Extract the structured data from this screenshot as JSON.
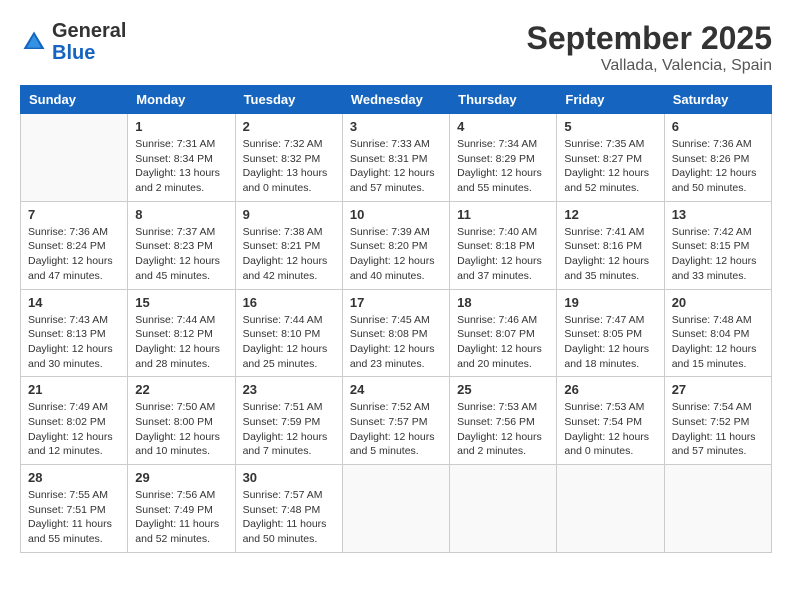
{
  "header": {
    "logo_general": "General",
    "logo_blue": "Blue",
    "month_title": "September 2025",
    "location": "Vallada, Valencia, Spain"
  },
  "days_of_week": [
    "Sunday",
    "Monday",
    "Tuesday",
    "Wednesday",
    "Thursday",
    "Friday",
    "Saturday"
  ],
  "weeks": [
    [
      {
        "day": "",
        "info": ""
      },
      {
        "day": "1",
        "info": "Sunrise: 7:31 AM\nSunset: 8:34 PM\nDaylight: 13 hours\nand 2 minutes."
      },
      {
        "day": "2",
        "info": "Sunrise: 7:32 AM\nSunset: 8:32 PM\nDaylight: 13 hours\nand 0 minutes."
      },
      {
        "day": "3",
        "info": "Sunrise: 7:33 AM\nSunset: 8:31 PM\nDaylight: 12 hours\nand 57 minutes."
      },
      {
        "day": "4",
        "info": "Sunrise: 7:34 AM\nSunset: 8:29 PM\nDaylight: 12 hours\nand 55 minutes."
      },
      {
        "day": "5",
        "info": "Sunrise: 7:35 AM\nSunset: 8:27 PM\nDaylight: 12 hours\nand 52 minutes."
      },
      {
        "day": "6",
        "info": "Sunrise: 7:36 AM\nSunset: 8:26 PM\nDaylight: 12 hours\nand 50 minutes."
      }
    ],
    [
      {
        "day": "7",
        "info": "Sunrise: 7:36 AM\nSunset: 8:24 PM\nDaylight: 12 hours\nand 47 minutes."
      },
      {
        "day": "8",
        "info": "Sunrise: 7:37 AM\nSunset: 8:23 PM\nDaylight: 12 hours\nand 45 minutes."
      },
      {
        "day": "9",
        "info": "Sunrise: 7:38 AM\nSunset: 8:21 PM\nDaylight: 12 hours\nand 42 minutes."
      },
      {
        "day": "10",
        "info": "Sunrise: 7:39 AM\nSunset: 8:20 PM\nDaylight: 12 hours\nand 40 minutes."
      },
      {
        "day": "11",
        "info": "Sunrise: 7:40 AM\nSunset: 8:18 PM\nDaylight: 12 hours\nand 37 minutes."
      },
      {
        "day": "12",
        "info": "Sunrise: 7:41 AM\nSunset: 8:16 PM\nDaylight: 12 hours\nand 35 minutes."
      },
      {
        "day": "13",
        "info": "Sunrise: 7:42 AM\nSunset: 8:15 PM\nDaylight: 12 hours\nand 33 minutes."
      }
    ],
    [
      {
        "day": "14",
        "info": "Sunrise: 7:43 AM\nSunset: 8:13 PM\nDaylight: 12 hours\nand 30 minutes."
      },
      {
        "day": "15",
        "info": "Sunrise: 7:44 AM\nSunset: 8:12 PM\nDaylight: 12 hours\nand 28 minutes."
      },
      {
        "day": "16",
        "info": "Sunrise: 7:44 AM\nSunset: 8:10 PM\nDaylight: 12 hours\nand 25 minutes."
      },
      {
        "day": "17",
        "info": "Sunrise: 7:45 AM\nSunset: 8:08 PM\nDaylight: 12 hours\nand 23 minutes."
      },
      {
        "day": "18",
        "info": "Sunrise: 7:46 AM\nSunset: 8:07 PM\nDaylight: 12 hours\nand 20 minutes."
      },
      {
        "day": "19",
        "info": "Sunrise: 7:47 AM\nSunset: 8:05 PM\nDaylight: 12 hours\nand 18 minutes."
      },
      {
        "day": "20",
        "info": "Sunrise: 7:48 AM\nSunset: 8:04 PM\nDaylight: 12 hours\nand 15 minutes."
      }
    ],
    [
      {
        "day": "21",
        "info": "Sunrise: 7:49 AM\nSunset: 8:02 PM\nDaylight: 12 hours\nand 12 minutes."
      },
      {
        "day": "22",
        "info": "Sunrise: 7:50 AM\nSunset: 8:00 PM\nDaylight: 12 hours\nand 10 minutes."
      },
      {
        "day": "23",
        "info": "Sunrise: 7:51 AM\nSunset: 7:59 PM\nDaylight: 12 hours\nand 7 minutes."
      },
      {
        "day": "24",
        "info": "Sunrise: 7:52 AM\nSunset: 7:57 PM\nDaylight: 12 hours\nand 5 minutes."
      },
      {
        "day": "25",
        "info": "Sunrise: 7:53 AM\nSunset: 7:56 PM\nDaylight: 12 hours\nand 2 minutes."
      },
      {
        "day": "26",
        "info": "Sunrise: 7:53 AM\nSunset: 7:54 PM\nDaylight: 12 hours\nand 0 minutes."
      },
      {
        "day": "27",
        "info": "Sunrise: 7:54 AM\nSunset: 7:52 PM\nDaylight: 11 hours\nand 57 minutes."
      }
    ],
    [
      {
        "day": "28",
        "info": "Sunrise: 7:55 AM\nSunset: 7:51 PM\nDaylight: 11 hours\nand 55 minutes."
      },
      {
        "day": "29",
        "info": "Sunrise: 7:56 AM\nSunset: 7:49 PM\nDaylight: 11 hours\nand 52 minutes."
      },
      {
        "day": "30",
        "info": "Sunrise: 7:57 AM\nSunset: 7:48 PM\nDaylight: 11 hours\nand 50 minutes."
      },
      {
        "day": "",
        "info": ""
      },
      {
        "day": "",
        "info": ""
      },
      {
        "day": "",
        "info": ""
      },
      {
        "day": "",
        "info": ""
      }
    ]
  ]
}
